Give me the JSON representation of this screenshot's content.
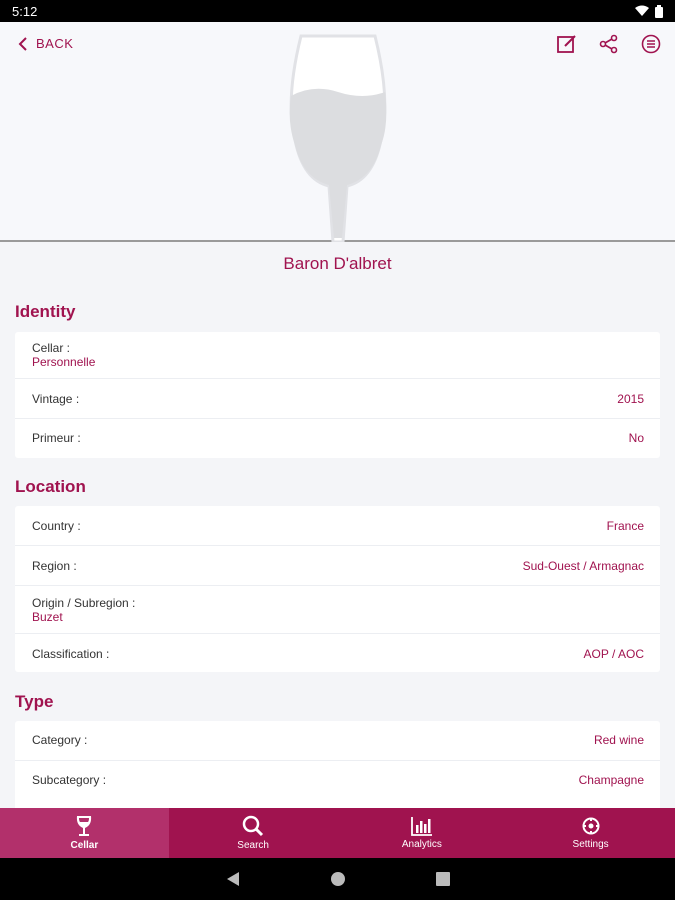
{
  "status_bar": {
    "time": "5:12"
  },
  "header": {
    "back_label": "BACK"
  },
  "wine": {
    "name": "Baron D'albret"
  },
  "identity": {
    "title": "Identity",
    "cellar_label": "Cellar :",
    "cellar_value": "Personnelle",
    "vintage_label": "Vintage :",
    "vintage_value": "2015",
    "primeur_label": "Primeur :",
    "primeur_value": "No"
  },
  "location": {
    "title": "Location",
    "country_label": "Country :",
    "country_value": "France",
    "region_label": "Region :",
    "region_value": "Sud-Ouest / Armagnac",
    "origin_label": "Origin / Subregion :",
    "origin_value": "Buzet",
    "classification_label": "Classification :",
    "classification_value": "AOP / AOC"
  },
  "type": {
    "title": "Type",
    "category_label": "Category :",
    "category_value": "Red wine",
    "subcategory_label": "Subcategory :",
    "subcategory_value": "Champagne"
  },
  "tabs": [
    {
      "label": "Cellar",
      "icon": "wine-glass-icon"
    },
    {
      "label": "Search",
      "icon": "search-icon"
    },
    {
      "label": "Analytics",
      "icon": "analytics-icon"
    },
    {
      "label": "Settings",
      "icon": "settings-icon"
    }
  ],
  "colors": {
    "accent": "#a0134f",
    "tab_active": "#b2306b",
    "background": "#f4f5f8"
  }
}
